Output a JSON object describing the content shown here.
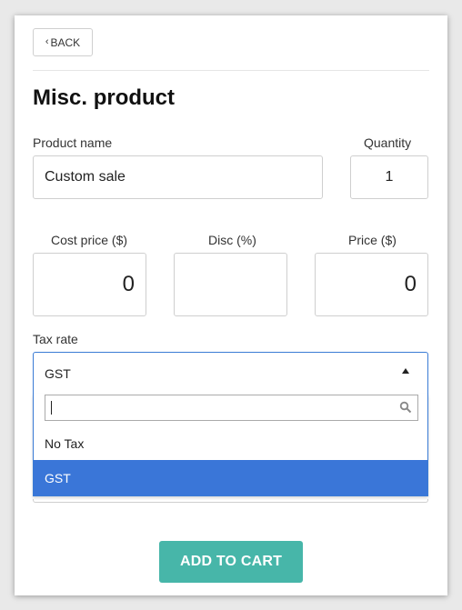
{
  "header": {
    "back_label": "BACK",
    "back_icon": "chevron-left-icon"
  },
  "page": {
    "title": "Misc. product"
  },
  "form": {
    "product_name_label": "Product name",
    "product_name_value": "Custom sale",
    "quantity_label": "Quantity",
    "quantity_value": "1",
    "cost_price_label": "Cost price ($)",
    "cost_price_value": "0",
    "disc_label": "Disc (%)",
    "disc_value": "",
    "price_label": "Price ($)",
    "price_value": "0",
    "tax_rate_label": "Tax rate",
    "tax_rate_selected": "GST",
    "tax_search_value": "",
    "tax_options": [
      "No Tax",
      "GST"
    ],
    "highlighted_option": "GST"
  },
  "actions": {
    "add_to_cart_label": "ADD TO CART"
  },
  "colors": {
    "accent": "#47b6a9",
    "highlight": "#3a76d8",
    "select_border": "#3a7bd5"
  }
}
